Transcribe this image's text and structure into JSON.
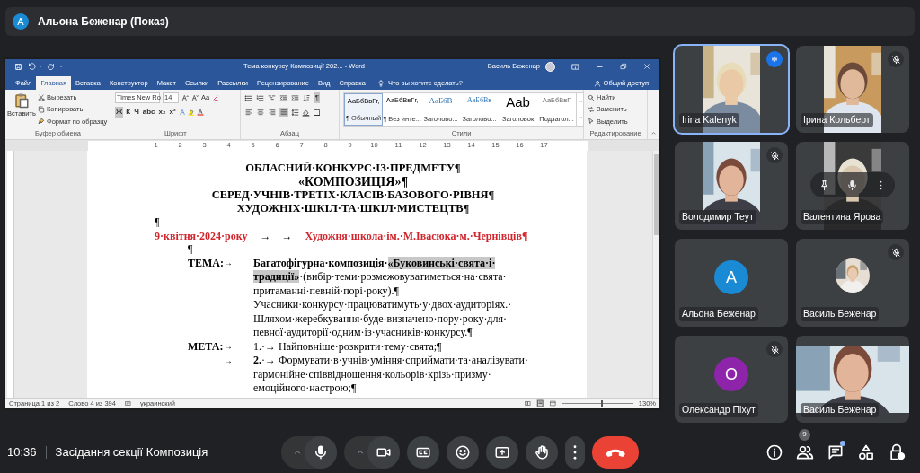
{
  "presenter_bar": {
    "avatar": "А",
    "label": "Альона Беженар (Показ)"
  },
  "word": {
    "title": "Тема конкурсу Композиції 202... - Word",
    "user": "Василь Беженар",
    "tabs": [
      {
        "label": "Файл",
        "selected": false
      },
      {
        "label": "Главная",
        "selected": true
      },
      {
        "label": "Вставка",
        "selected": false
      },
      {
        "label": "Конструктор",
        "selected": false
      },
      {
        "label": "Макет",
        "selected": false
      },
      {
        "label": "Ссылки",
        "selected": false
      },
      {
        "label": "Рассылки",
        "selected": false
      },
      {
        "label": "Рецензирование",
        "selected": false
      },
      {
        "label": "Вид",
        "selected": false
      },
      {
        "label": "Справка",
        "selected": false
      }
    ],
    "tell_me": "Что вы хотите сделать?",
    "share": "Общий доступ",
    "clipboard": {
      "paste": "Вставить",
      "items": [
        "Вырезать",
        "Копировать",
        "Формат по образцу"
      ],
      "label": "Буфер обмена"
    },
    "font": {
      "name": "Times New Ro",
      "size": "14",
      "case": "Аа",
      "format_buttons": [
        {
          "label": "Ж",
          "selected": true
        },
        {
          "label": "К",
          "selected": false
        },
        {
          "label": "Ч",
          "selected": false
        },
        {
          "label": "abc",
          "selected": false
        },
        {
          "label": "x₂",
          "selected": false
        },
        {
          "label": "x²",
          "selected": false
        }
      ],
      "label": "Шрифт"
    },
    "paragraph": {
      "align_buttons": [
        {
          "kind": "left",
          "selected": false
        },
        {
          "kind": "center",
          "selected": false
        },
        {
          "kind": "right",
          "selected": false
        },
        {
          "kind": "justify",
          "selected": true
        }
      ],
      "marks": {
        "label": "¶",
        "selected": true
      },
      "label": "Абзац"
    },
    "styles": {
      "items": [
        {
          "sample": "АаБбВвГг,",
          "name": "¶ Обычный",
          "selected": true,
          "kind": "small"
        },
        {
          "sample": "АаБбВвГг,",
          "name": "¶ Без инте...",
          "selected": false,
          "kind": "small"
        },
        {
          "sample": "АаБбВ",
          "name": "Заголово...",
          "selected": false,
          "kind": "heading"
        },
        {
          "sample": "АаБбВв",
          "name": "Заголово...",
          "selected": false,
          "kind": "heading2"
        },
        {
          "sample": "Aab",
          "name": "Заголовок",
          "selected": false,
          "kind": "title"
        },
        {
          "sample": "АаБбВвГ",
          "name": "Подзагол...",
          "selected": false,
          "kind": "subtitle"
        }
      ],
      "label": "Стили"
    },
    "editing": {
      "items": [
        "Найти",
        "Заменить",
        "Выделить"
      ],
      "label": "Редактирование"
    },
    "ruler": [
      "1",
      "2",
      "3",
      "4",
      "5",
      "6",
      "7",
      "8",
      "9",
      "10",
      "11",
      "12",
      "13",
      "14",
      "15",
      "16",
      "17"
    ],
    "document": [
      {
        "kind": "heading",
        "text": "ОБЛАСНИЙ·КОНКУРС·ІЗ·ПРЕДМЕТУ¶"
      },
      {
        "kind": "heading_large",
        "text": "«КОМПОЗИЦІЯ»¶"
      },
      {
        "kind": "heading",
        "text": "СЕРЕД·УЧНІВ·ТРЕТІХ·КЛАСІВ·БАЗОВОГО·РІВНЯ¶"
      },
      {
        "kind": "heading",
        "text": "ХУДОЖНІХ·ШКІЛ·ТА·ШКІЛ·МИСТЕЦТВ¶"
      },
      {
        "kind": "mark",
        "text": "¶"
      },
      {
        "kind": "dateline",
        "date": "9·квітня·2024·року",
        "tabs": "→    →",
        "school": "Художня·школа·ім.·М.Івасюка·м.·Чернівців¶"
      },
      {
        "kind": "mark_indented",
        "text": "¶"
      },
      {
        "kind": "body",
        "label": "ТЕМА:",
        "tab": "→",
        "parts": [
          {
            "text": "Багатофігурна·композиція·",
            "bold": true,
            "highlight": false
          },
          {
            "text": "«Буковинські·свята·і·",
            "bold": true,
            "highlight": true
          }
        ]
      },
      {
        "kind": "body",
        "parts": [
          {
            "text": "традиції»",
            "bold": true,
            "highlight": true
          },
          {
            "text": "·(вибір·теми·розмежовуватиметься·на·свята·",
            "bold": false,
            "highlight": false
          }
        ]
      },
      {
        "kind": "body",
        "parts": [
          {
            "text": "притаманні·певній·порі·року).¶",
            "bold": false,
            "highlight": false
          }
        ]
      },
      {
        "kind": "body",
        "parts": [
          {
            "text": "Учасники·конкурсу·працюватимуть·у·двох·аудиторіях.·",
            "bold": false,
            "highlight": false
          }
        ]
      },
      {
        "kind": "body",
        "parts": [
          {
            "text": "Шляхом·жеребкування·буде·визначено·пору·року·для·",
            "bold": false,
            "highlight": false
          }
        ]
      },
      {
        "kind": "body",
        "parts": [
          {
            "text": "певної·аудиторії·одним·із·учасників·конкурсу.¶",
            "bold": false,
            "highlight": false
          }
        ]
      },
      {
        "kind": "body",
        "label": "МЕТА:",
        "tab": "→",
        "parts": [
          {
            "text": "1.·→ Найповніше·розкрити·тему·свята;¶",
            "bold": false,
            "highlight": false
          }
        ]
      },
      {
        "kind": "body",
        "tab": "→",
        "parts": [
          {
            "text": "2.",
            "bold": true,
            "highlight": false
          },
          {
            "text": "·→ Формувати·в·учнів·уміння·сприймати·та·аналізувати·",
            "bold": false,
            "highlight": false
          }
        ]
      },
      {
        "kind": "body",
        "parts": [
          {
            "text": "гармонійне·співвідношення·кольорів·крізь·призму·",
            "bold": false,
            "highlight": false
          }
        ]
      },
      {
        "kind": "body",
        "parts": [
          {
            "text": "емоційного·настрою;¶",
            "bold": false,
            "highlight": false
          }
        ]
      }
    ],
    "status": {
      "page": "Страница 1 из 2",
      "words": "Слово 4 из 394",
      "language": "украинский",
      "zoom": "130%",
      "zoom_slider": {
        "level": 0.55
      }
    }
  },
  "tiles": [
    {
      "name": "Irina Kalenyk",
      "kind": "video",
      "speaking": true,
      "muted": false,
      "hover": false
    },
    {
      "name": "Ірина Кольберт",
      "kind": "video",
      "speaking": false,
      "muted": true,
      "hover": false
    },
    {
      "name": "Володимир Теут",
      "kind": "video",
      "speaking": false,
      "muted": true,
      "hover": false
    },
    {
      "name": "Валентина Ярова",
      "kind": "video",
      "speaking": false,
      "muted": false,
      "hover": true
    },
    {
      "name": "Альона Беженар",
      "kind": "avatar",
      "avatar": "А",
      "color": "#1a8ad4",
      "speaking": false,
      "muted": false,
      "hover": false
    },
    {
      "name": "Василь Беженар",
      "kind": "photo_avatar",
      "speaking": false,
      "muted": true,
      "hover": false
    },
    {
      "name": "Олександр Піхут",
      "kind": "avatar",
      "avatar": "О",
      "color": "#8e24aa",
      "speaking": false,
      "muted": true,
      "hover": false
    },
    {
      "name": "Василь Беженар",
      "kind": "video_wide",
      "speaking": false,
      "muted": false,
      "hover": false
    }
  ],
  "bottom_bar": {
    "time": "10:36",
    "meeting": "Засідання секції Композиція",
    "participants_count": "9",
    "chat_unread": true
  }
}
